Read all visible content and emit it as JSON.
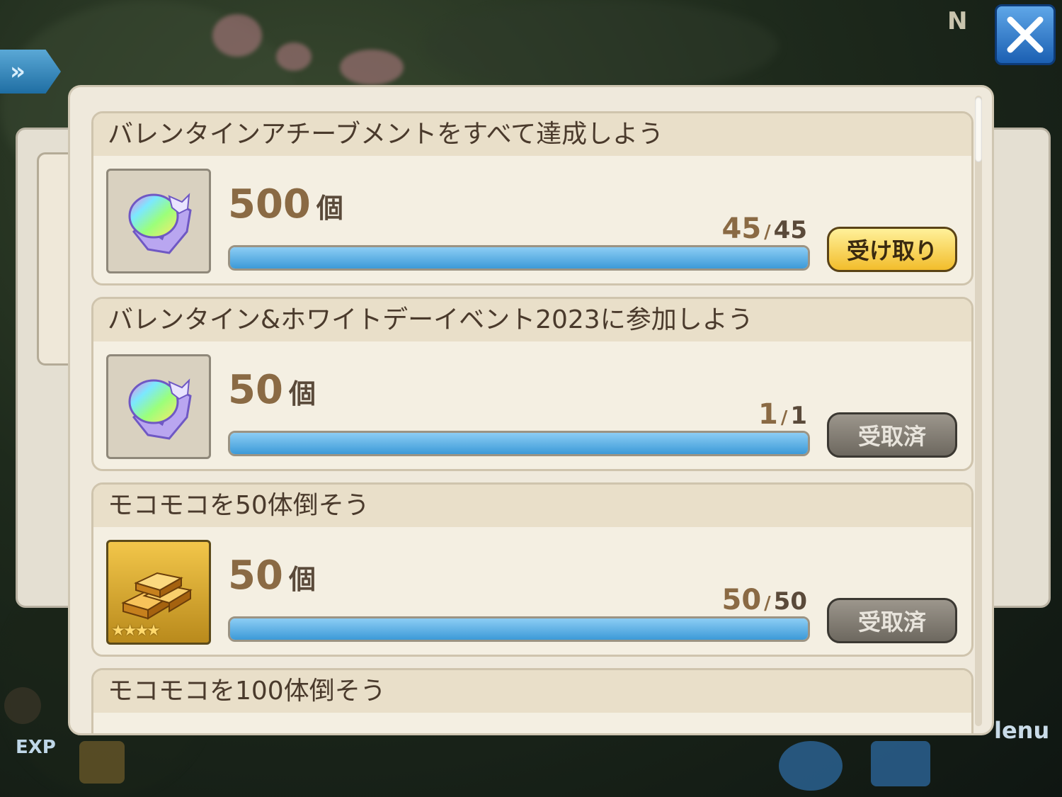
{
  "colors": {
    "bar_fill": "#4aa6e0",
    "claim_button": "#f5c93b",
    "done_button": "#7d786f",
    "close_button": "#2f7fd4"
  },
  "hud": {
    "close_icon": "close-icon",
    "arrow_label": "»",
    "compass_label": "N",
    "exp_label": "EXP",
    "menu_label": "lenu"
  },
  "achievements": [
    {
      "title": "バレンタインアチーブメントをすべて達成しよう",
      "reward_icon": "rainbow-crystal-icon",
      "reward_amount": "500",
      "reward_unit": "個",
      "progress_current": "45",
      "progress_max": "45",
      "progress_fraction": 1.0,
      "button_label": "受け取り",
      "button_state": "claimable"
    },
    {
      "title": "バレンタイン&ホワイトデーイベント2023に参加しよう",
      "reward_icon": "rainbow-crystal-icon",
      "reward_amount": "50",
      "reward_unit": "個",
      "progress_current": "1",
      "progress_max": "1",
      "progress_fraction": 1.0,
      "button_label": "受取済",
      "button_state": "claimed"
    },
    {
      "title": "モコモコを50体倒そう",
      "reward_icon": "gold-bars-icon",
      "reward_stars": "★★★★",
      "reward_amount": "50",
      "reward_unit": "個",
      "progress_current": "50",
      "progress_max": "50",
      "progress_fraction": 1.0,
      "button_label": "受取済",
      "button_state": "claimed"
    },
    {
      "title": "モコモコを100体倒そう"
    }
  ]
}
